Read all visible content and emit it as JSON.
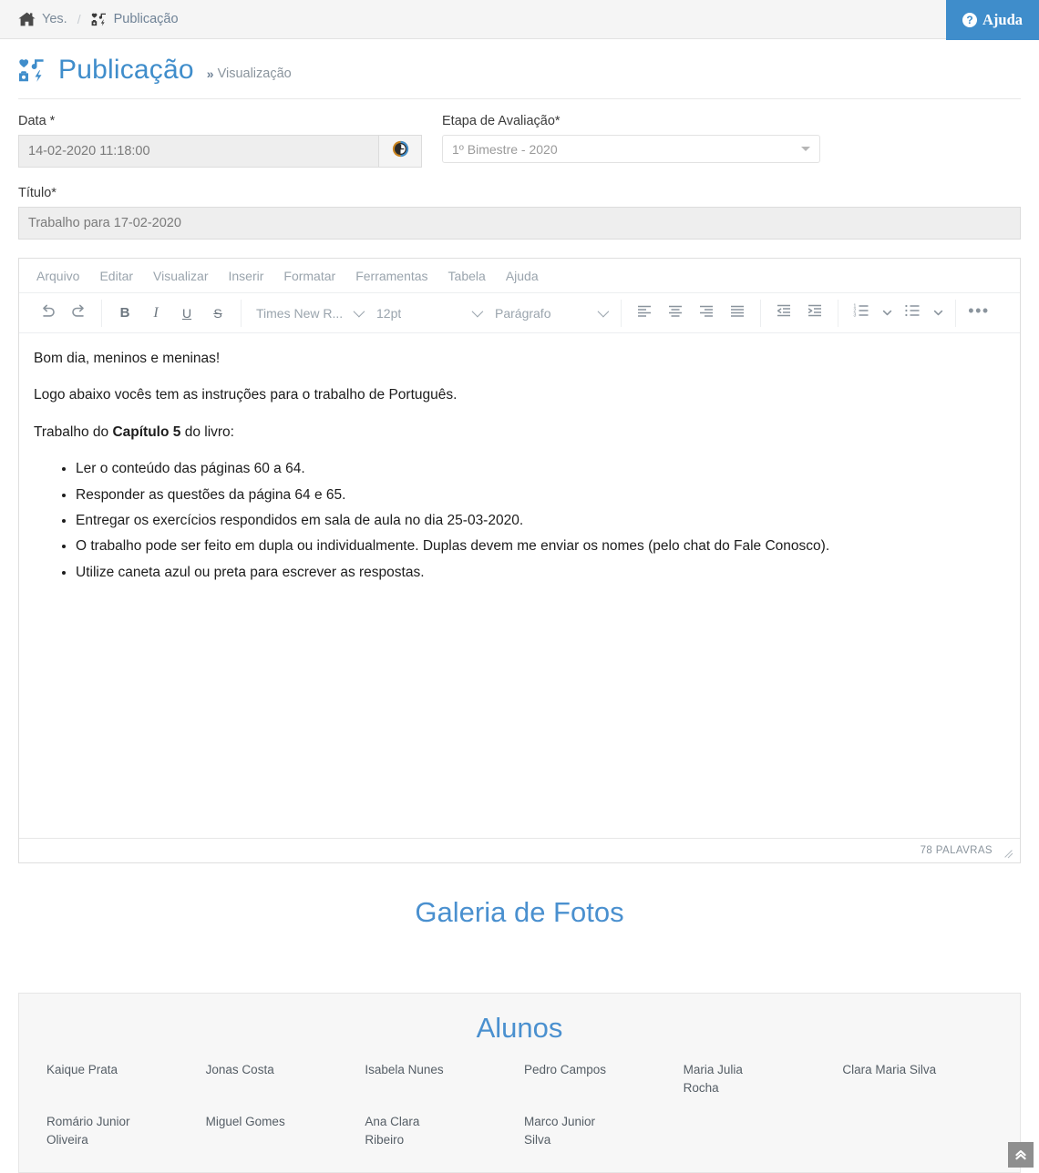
{
  "topbar": {
    "home_icon": "home-icon",
    "home_label": "Yes.",
    "separator": "/",
    "crumb_icon": "publication-icon",
    "crumb_label": "Publicação",
    "help_label": "Ajuda",
    "help_icon": "question-circle-icon",
    "accent_color": "#3f8dcb"
  },
  "page_head": {
    "icon": "publication-icon",
    "title": "Publicação",
    "chevron": "»",
    "subtitle": "Visualização",
    "title_color": "#3f8dcb"
  },
  "form": {
    "data": {
      "label": "Data *",
      "value": "14-02-2020 11:18:00",
      "button_icon": "clock-icon"
    },
    "etapa": {
      "label": "Etapa de Avaliação",
      "required_mark": "*",
      "value": "1º Bimestre - 2020",
      "caret_icon": "chevron-down-icon"
    },
    "titulo": {
      "label": "Título",
      "required_mark": "*",
      "value": "Trabalho para 17-02-2020"
    }
  },
  "editor": {
    "menu": [
      {
        "label": "Arquivo"
      },
      {
        "label": "Editar"
      },
      {
        "label": "Visualizar"
      },
      {
        "label": "Inserir"
      },
      {
        "label": "Formatar"
      },
      {
        "label": "Ferramentas"
      },
      {
        "label": "Tabela"
      },
      {
        "label": "Ajuda"
      }
    ],
    "toolbar": {
      "undo_icon": "undo-icon",
      "redo_icon": "redo-icon",
      "bold_label": "B",
      "italic_label": "I",
      "underline_label": "U",
      "strike_label": "S",
      "font_family": "Times New R...",
      "font_size": "12pt",
      "block_format": "Parágrafo",
      "align_left_icon": "align-left-icon",
      "align_center_icon": "align-center-icon",
      "align_right_icon": "align-right-icon",
      "align_justify_icon": "align-justify-icon",
      "outdent_icon": "outdent-icon",
      "indent_icon": "indent-icon",
      "numlist_icon": "numbered-list-icon",
      "bullist_icon": "bullet-list-icon",
      "overflow_label": "•••"
    },
    "content": {
      "paragraphs": [
        "Bom dia, meninos e meninas!",
        "Logo abaixo vocês tem as instruções para o trabalho de Português."
      ],
      "chapter_line_prefix": "Trabalho do ",
      "chapter_bold": "Capítulo 5",
      "chapter_line_suffix": " do livro:",
      "bullets": [
        "Ler o conteúdo das páginas 60 a 64.",
        "Responder as questões da página 64 e 65.",
        "Entregar os exercícios respondidos em sala de aula no dia 25-03-2020.",
        "O trabalho pode ser feito em dupla ou individualmente. Duplas devem me enviar os nomes (pelo chat do Fale Conosco).",
        "Utilize caneta azul ou preta para escrever as respostas."
      ]
    },
    "statusbar": {
      "word_count": "78 PALAVRAS",
      "resize_icon": "resize-handle-icon"
    }
  },
  "galeria": {
    "title": "Galeria de Fotos"
  },
  "alunos": {
    "title": "Alunos",
    "names": [
      "Kaique Prata",
      "Jonas Costa",
      "Isabela Nunes",
      "Pedro Campos",
      "Maria Julia Rocha",
      "Clara Maria Silva",
      "Romário Junior Oliveira",
      "Miguel Gomes",
      "Ana Clara Ribeiro",
      "Marco Junior Silva"
    ]
  },
  "scroll_top": {
    "icon": "double-chevron-up-icon"
  }
}
